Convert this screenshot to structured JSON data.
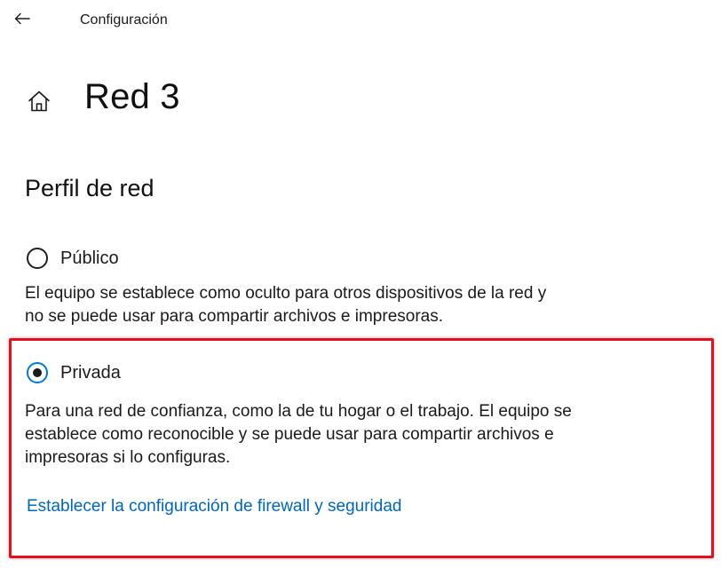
{
  "header": {
    "back_icon": "back-arrow-icon",
    "title": "Configuración"
  },
  "page": {
    "home_icon": "home-icon",
    "title": "Red 3"
  },
  "section": {
    "heading": "Perfil de red"
  },
  "profiles": [
    {
      "label": "Público",
      "selected": false,
      "description_line1": "El equipo se establece como oculto para otros dispositivos de la red y",
      "description_line2": "no se puede usar para compartir archivos e impresoras."
    },
    {
      "label": "Privada",
      "selected": true,
      "description_line1": "Para una red de confianza, como la de tu hogar o el trabajo. El equipo se",
      "description_line2": "establece como reconocible y se puede usar para compartir archivos e",
      "description_line3": "impresoras si lo configuras."
    }
  ],
  "link": {
    "label": "Establecer la configuración de firewall y seguridad"
  },
  "colors": {
    "accent": "#0078d7",
    "link": "#0067b8",
    "highlight": "#e0121f"
  }
}
